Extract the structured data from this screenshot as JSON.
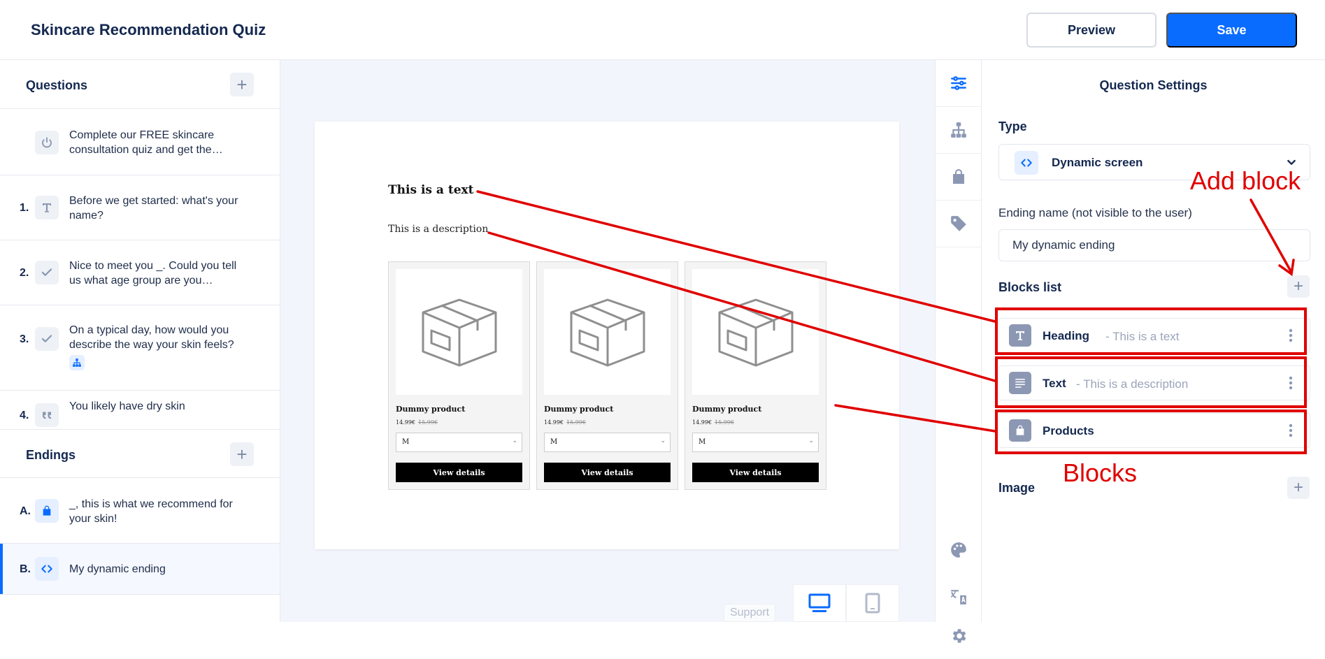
{
  "header": {
    "app_title": "Skincare Recommendation Quiz",
    "preview_label": "Preview",
    "save_label": "Save"
  },
  "questions": {
    "title": "Questions",
    "intro": {
      "text": "Complete our FREE skincare consultation quiz and get the…",
      "icon": "power-icon"
    },
    "items": [
      {
        "num": "1.",
        "text": "Before we get started: what's your name?",
        "icon": "text-type-icon"
      },
      {
        "num": "2.",
        "text": "Nice to meet you _. Could you tell us what age group are you…",
        "icon": "check-icon"
      },
      {
        "num": "3.",
        "text": "On a typical day, how would you describe the way your skin feels?",
        "icon": "check-icon",
        "badge": "branch-icon"
      },
      {
        "num": "4.",
        "text": "You likely have dry skin",
        "icon": "quote-icon"
      }
    ]
  },
  "endings": {
    "title": "Endings",
    "items": [
      {
        "letter": "A.",
        "text": "_, this is what we recommend for your skin!",
        "icon": "bag-icon"
      },
      {
        "letter": "B.",
        "text": "My dynamic ending",
        "icon": "code-icon",
        "active": true
      }
    ]
  },
  "preview": {
    "heading": "This is a text",
    "description": "This is a description",
    "products": [
      {
        "name": "Dummy product",
        "price": "14.99€",
        "old_price": "15.99€",
        "option": "M",
        "button": "View details"
      },
      {
        "name": "Dummy product",
        "price": "14.99€",
        "old_price": "15.99€",
        "option": "M",
        "button": "View details"
      },
      {
        "name": "Dummy product",
        "price": "14.99€",
        "old_price": "15.99€",
        "option": "M",
        "button": "View details"
      }
    ],
    "support_label": "Support",
    "devices": [
      "desktop-icon",
      "tablet-icon"
    ]
  },
  "tools": [
    "sliders-icon",
    "sitemap-icon",
    "bag-icon",
    "tag-icon",
    "palette-icon",
    "translate-icon",
    "gear-icon"
  ],
  "settings": {
    "title": "Question Settings",
    "type_label": "Type",
    "type_value": "Dynamic screen",
    "ending_name_label": "Ending name (not visible to the user)",
    "ending_name_value": "My dynamic ending",
    "blocks_label": "Blocks list",
    "blocks": [
      {
        "name": "Heading",
        "desc": "- This is a text",
        "icon": "text-type-icon"
      },
      {
        "name": "Text",
        "desc": "- This is a description",
        "icon": "paragraph-icon"
      },
      {
        "name": "Products",
        "desc": "",
        "icon": "bag-icon"
      }
    ],
    "image_label": "Image"
  },
  "annotations": {
    "add_block": "Add block",
    "blocks": "Blocks",
    "color": "#e00000"
  },
  "colors": {
    "accent": "#0a6cff",
    "navy": "#142850"
  }
}
